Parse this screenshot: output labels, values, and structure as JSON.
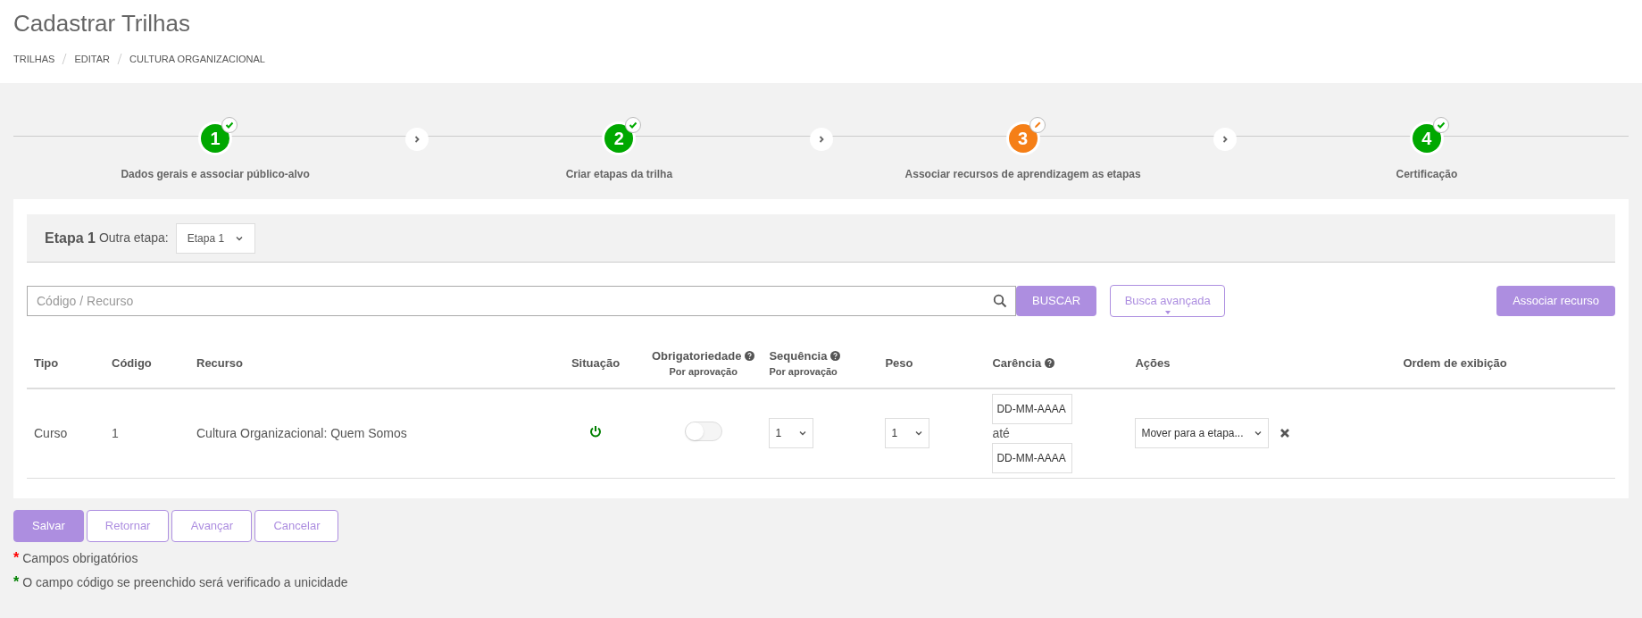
{
  "page_title": "Cadastrar Trilhas",
  "breadcrumb": [
    "TRILHAS",
    "EDITAR",
    "CULTURA ORGANIZACIONAL"
  ],
  "steps": [
    {
      "number": "1",
      "label": "Dados gerais e associar público-alvo",
      "kind": "done"
    },
    {
      "number": "2",
      "label": "Criar etapas da trilha",
      "kind": "done"
    },
    {
      "number": "3",
      "label": "Associar recursos de aprendizagem as etapas",
      "kind": "editing"
    },
    {
      "number": "4",
      "label": "Certificação",
      "kind": "done"
    }
  ],
  "stage_panel": {
    "title": "Etapa 1",
    "other_label": "Outra etapa:",
    "other_value": "Etapa 1"
  },
  "search": {
    "placeholder": "Código / Recurso",
    "search_button": "BUSCAR",
    "advanced_button": "Busca avançada",
    "associate_button": "Associar recurso"
  },
  "table": {
    "columns": [
      {
        "label": "Tipo",
        "help": false
      },
      {
        "label": "Código",
        "help": false
      },
      {
        "label": "Recurso",
        "help": false
      },
      {
        "label": "Situação",
        "help": false,
        "center": true
      },
      {
        "label": "Obrigatoriedade",
        "sub": "Por aprovação",
        "help": true,
        "center": true
      },
      {
        "label": "Sequência",
        "sub": "Por aprovação",
        "help": true
      },
      {
        "label": "Peso",
        "help": false
      },
      {
        "label": "Carência",
        "help": true
      },
      {
        "label": "Ações",
        "help": false
      },
      {
        "label": "Ordem de exibição",
        "help": false
      }
    ],
    "rows": [
      {
        "tipo": "Curso",
        "codigo": "1",
        "recurso": "Cultura Organizacional: Quem Somos",
        "active": true,
        "mandatory_on": false,
        "sequencia": "1",
        "peso": "1",
        "carencia_from": "DD-MM-AAAA",
        "carencia_sep": "até",
        "carencia_to": "DD-MM-AAAA",
        "acao": "Mover para a etapa..."
      }
    ]
  },
  "buttons": [
    {
      "label": "Salvar",
      "primary": true
    },
    {
      "label": "Retornar",
      "primary": false
    },
    {
      "label": "Avançar",
      "primary": false
    },
    {
      "label": "Cancelar",
      "primary": false
    }
  ],
  "notes": [
    {
      "mark": "*",
      "text": "Campos obrigatórios",
      "color": "#ff0000"
    },
    {
      "mark": "*",
      "text": "O campo código se preenchido será verificado a unicidade",
      "color": "#008000"
    }
  ]
}
